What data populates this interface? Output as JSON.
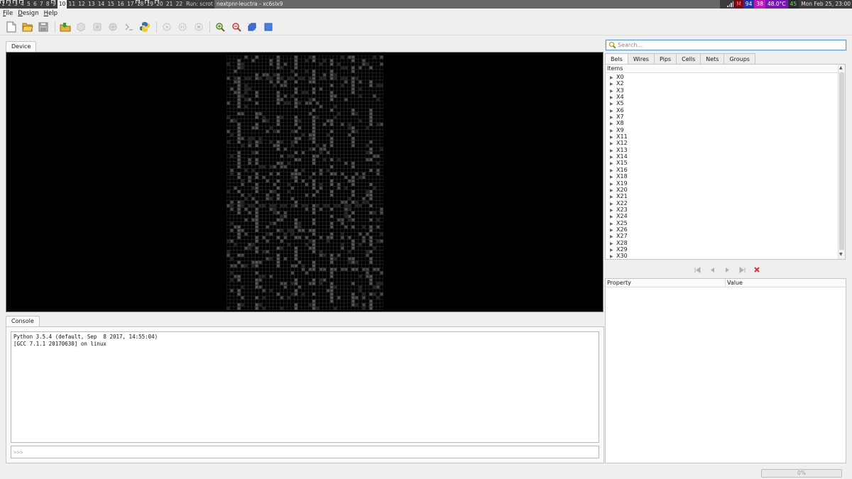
{
  "taskbar": {
    "workspaces": [
      {
        "label": "1",
        "occupied": true
      },
      {
        "label": "2",
        "occupied": true
      },
      {
        "label": "3",
        "occupied": true
      },
      {
        "label": "4",
        "occupied": true
      },
      {
        "label": "5"
      },
      {
        "label": "6"
      },
      {
        "label": "7"
      },
      {
        "label": "8"
      },
      {
        "label": "9",
        "occupied": true
      },
      {
        "label": "10",
        "active": true
      },
      {
        "label": "11"
      },
      {
        "label": "12"
      },
      {
        "label": "13"
      },
      {
        "label": "14"
      },
      {
        "label": "15"
      },
      {
        "label": "16"
      },
      {
        "label": "17"
      },
      {
        "label": "18",
        "occupied": true
      },
      {
        "label": "19",
        "occupied": true
      },
      {
        "label": "20",
        "occupied": true
      },
      {
        "label": "21"
      },
      {
        "label": "22"
      }
    ],
    "run_command": "Run: scrot",
    "window_title": "nextpnr-leuctra - xc6slx9",
    "memory_indicator": "M",
    "cpu_value": "94",
    "cpu_percent": "38",
    "temperature": "48.0°C",
    "count": "45",
    "clock": "Mon Feb 25, 23:00"
  },
  "menubar": {
    "items": [
      {
        "accel": "F",
        "rest": "ile"
      },
      {
        "accel": "D",
        "rest": "esign"
      },
      {
        "accel": "H",
        "rest": "elp"
      }
    ]
  },
  "toolbar": {
    "buttons": [
      "new-file-icon",
      "open-folder-icon",
      "save-icon",
      "load-design-icon",
      "pack-icon",
      "place-icon",
      "route-icon",
      "script-icon",
      "python-icon",
      "play-icon",
      "pause-icon",
      "stop-icon",
      "zoom-in-icon",
      "zoom-out-icon",
      "zoom-fit-icon",
      "zoom-selection-icon"
    ]
  },
  "device_tab": "Device",
  "console": {
    "tab": "Console",
    "output_lines": [
      "Python 3.5.4 (default, Sep  8 2017, 14:55:04)",
      "[GCC 7.1.1 20170630] on linux"
    ],
    "prompt": ">>>"
  },
  "search": {
    "placeholder": "Search..."
  },
  "side_tabs": [
    "Bels",
    "Wires",
    "Pips",
    "Cells",
    "Nets",
    "Groups"
  ],
  "tree": {
    "header": "Items",
    "items": [
      "X0",
      "X2",
      "X3",
      "X4",
      "X5",
      "X6",
      "X7",
      "X8",
      "X9",
      "X11",
      "X12",
      "X13",
      "X14",
      "X15",
      "X16",
      "X18",
      "X19",
      "X20",
      "X21",
      "X22",
      "X23",
      "X24",
      "X25",
      "X26",
      "X27",
      "X28",
      "X29",
      "X30"
    ]
  },
  "properties": {
    "col_property": "Property",
    "col_value": "Value"
  },
  "progress": {
    "label": "0%",
    "value": 0
  },
  "colors": {
    "device_background": "#000000",
    "grid_line": "#3a3a3a",
    "delete_red": "#e03030",
    "search_focus": "#5a9bd5"
  }
}
